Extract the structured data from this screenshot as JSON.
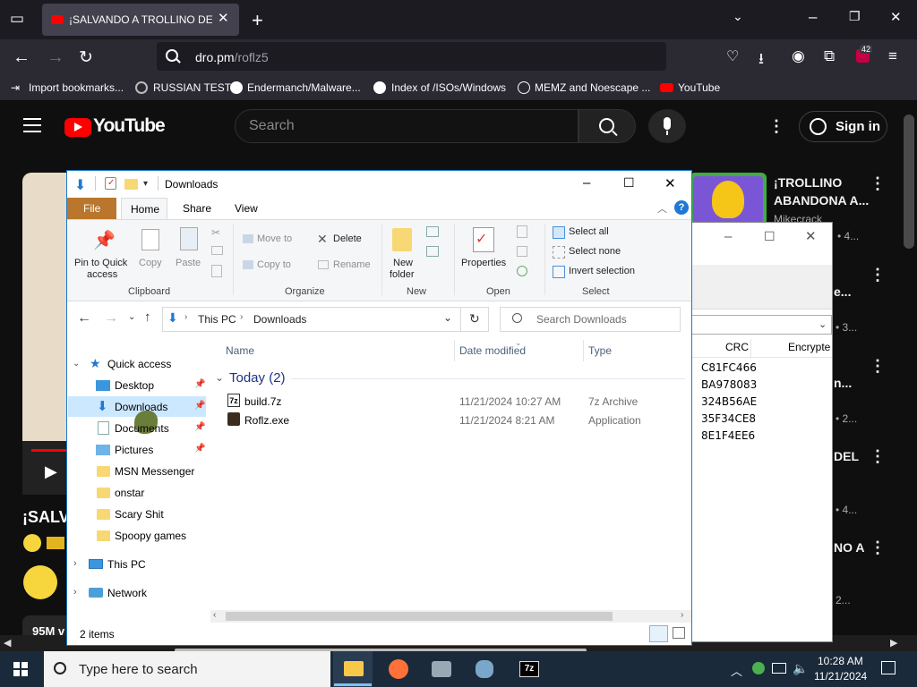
{
  "browser": {
    "tab_title": "¡SALVANDO A TROLLINO DE LA",
    "url_host": "dro.pm",
    "url_path": "/roflz5",
    "extension_badge": "42",
    "bookmarks": [
      "Import bookmarks...",
      "RUSSIAN TEST",
      "Endermanch/Malware...",
      "Index of /ISOs/Windows",
      "MEMZ and Noescape ...",
      "YouTube"
    ]
  },
  "youtube": {
    "logo_text": "YouTube",
    "search_placeholder": "Search",
    "signin_label": "Sign in",
    "video_title_fragment": "¡SALV",
    "views_fragment": "95M v",
    "recommendations": [
      {
        "title_line1": "¡TROLLINO",
        "title_line2": "ABANDONA A...",
        "channel": "Mikecrack",
        "meta": "• 4..."
      },
      {
        "title_fragment": "e...",
        "meta": "• 3..."
      },
      {
        "title_fragment": "n...",
        "meta": "• 2..."
      },
      {
        "title_fragment": "DEL",
        "meta": "• 4..."
      },
      {
        "title_fragment": "NO A",
        "meta": "2..."
      }
    ]
  },
  "zip7": {
    "col_crc": "CRC",
    "col_encrypted": "Encrypte",
    "crc_values": [
      "C81FC466",
      "BA978083",
      "324B56AE",
      "35F34CE8",
      "8E1F4EE6"
    ]
  },
  "explorer": {
    "title": "Downloads",
    "ribbon_tabs": {
      "file": "File",
      "home": "Home",
      "share": "Share",
      "view": "View"
    },
    "clipboard": {
      "pin_line1": "Pin to Quick",
      "pin_line2": "access",
      "copy": "Copy",
      "paste": "Paste",
      "group": "Clipboard"
    },
    "organize": {
      "move_to": "Move to",
      "copy_to": "Copy to",
      "delete": "Delete",
      "rename": "Rename",
      "group": "Organize"
    },
    "new": {
      "folder_line1": "New",
      "folder_line2": "folder",
      "group": "New"
    },
    "open": {
      "properties": "Properties",
      "group": "Open"
    },
    "select": {
      "all": "Select all",
      "none": "Select none",
      "invert": "Invert selection",
      "group": "Select"
    },
    "address": {
      "this_pc": "This PC",
      "downloads": "Downloads"
    },
    "search_placeholder": "Search Downloads",
    "nav": {
      "quick_access": "Quick access",
      "items": [
        "Desktop",
        "Downloads",
        "Documents",
        "Pictures",
        "MSN Messenger",
        "onstar",
        "Scary Shit",
        "Spoopy games"
      ],
      "this_pc": "This PC",
      "network": "Network"
    },
    "columns": {
      "name": "Name",
      "date": "Date modified",
      "type": "Type"
    },
    "group_header": "Today (2)",
    "files": [
      {
        "name": "build.7z",
        "date": "11/21/2024 10:27 AM",
        "type": "7z Archive"
      },
      {
        "name": "Roflz.exe",
        "date": "11/21/2024 8:21 AM",
        "type": "Application"
      }
    ],
    "status": "2 items"
  },
  "taskbar": {
    "search_placeholder": "Type here to search",
    "time": "10:28 AM",
    "date": "11/21/2024"
  }
}
